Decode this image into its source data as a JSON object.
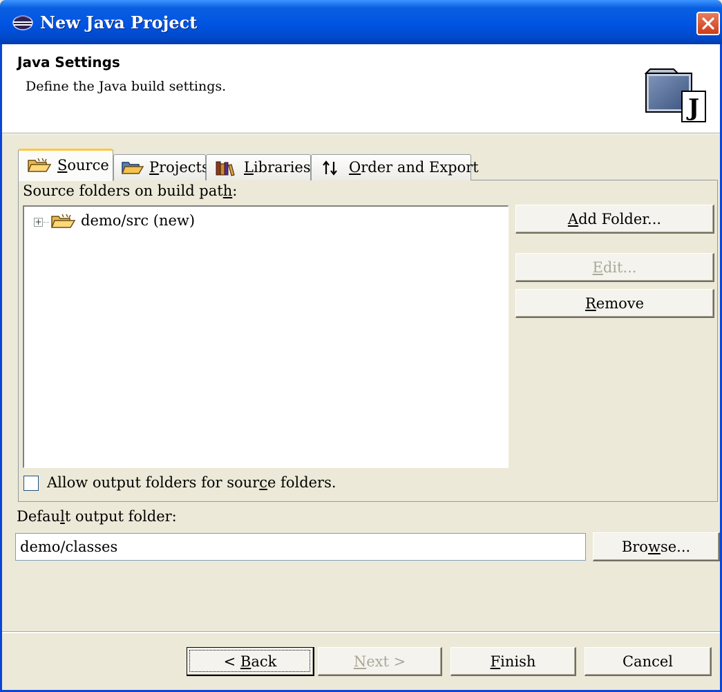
{
  "window": {
    "title": "New Java Project"
  },
  "header": {
    "title": "Java Settings",
    "description": "Define the Java build settings.",
    "icon": "java-project-icon"
  },
  "tabs": [
    {
      "pre": "",
      "mn": "S",
      "post": "ource",
      "icon": "source-folder-icon",
      "active": true
    },
    {
      "pre": "",
      "mn": "P",
      "post": "rojects",
      "icon": "projects-folder-icon",
      "active": false
    },
    {
      "pre": "",
      "mn": "L",
      "post": "ibraries",
      "icon": "libraries-icon",
      "active": false
    },
    {
      "pre": "",
      "mn": "O",
      "post": "rder and Export",
      "icon": "order-arrows-icon",
      "active": false
    }
  ],
  "source": {
    "list_label": {
      "pre": "Source folders on build pat",
      "mn": "h",
      "post": ":"
    },
    "tree": [
      {
        "label": "demo/src (new)",
        "expandable": true,
        "icon": "source-folder-icon"
      }
    ],
    "buttons": {
      "add_folder": {
        "pre": "",
        "mn": "A",
        "post": "dd Folder...",
        "enabled": true
      },
      "edit": {
        "pre": "",
        "mn": "E",
        "post": "dit...",
        "enabled": false
      },
      "remove": {
        "pre": "",
        "mn": "R",
        "post": "emove",
        "enabled": true
      }
    },
    "allow_output": {
      "pre": "Allow output folders for sour",
      "mn": "c",
      "post": "e folders.",
      "checked": false
    }
  },
  "output": {
    "label": {
      "pre": "Defau",
      "mn": "l",
      "post": "t output folder:"
    },
    "value": "demo/classes",
    "browse": {
      "pre": "Bro",
      "mn": "w",
      "post": "se..."
    }
  },
  "footer": {
    "back": {
      "pre": "< ",
      "mn": "B",
      "post": "ack",
      "enabled": true
    },
    "next": {
      "pre": "",
      "mn": "N",
      "post": "ext >",
      "enabled": false
    },
    "finish": {
      "pre": "",
      "mn": "F",
      "post": "inish",
      "enabled": true
    },
    "cancel": {
      "label": "Cancel",
      "enabled": true
    }
  },
  "colors": {
    "titlebar": "#0054e3",
    "dialog": "#ece9d8",
    "tab_highlight": "#ffc73c",
    "close": "#cf3b16"
  }
}
